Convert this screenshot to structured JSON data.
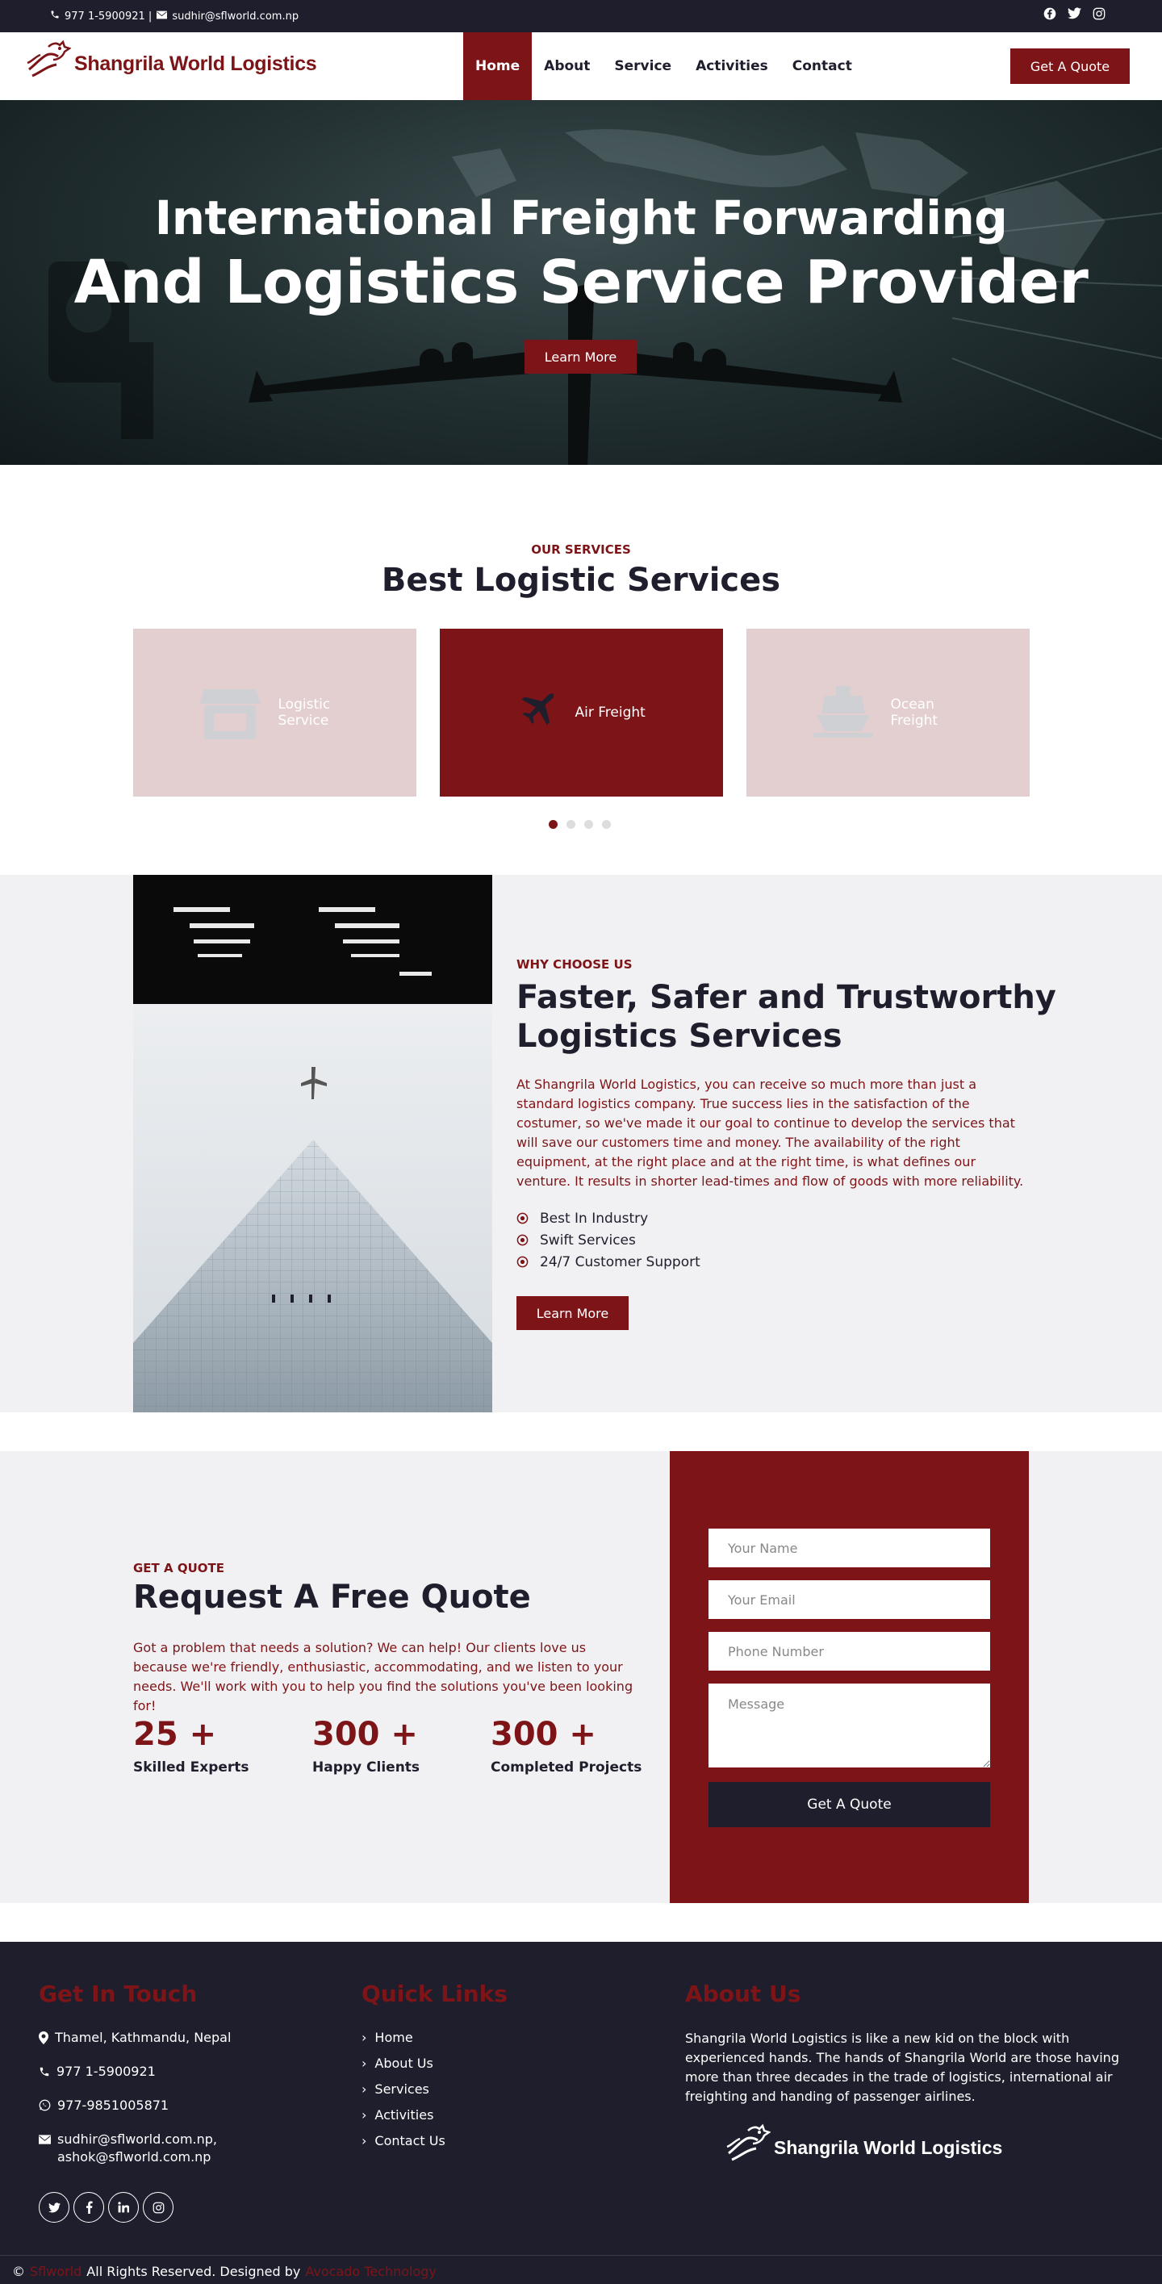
{
  "topbar": {
    "phone": "977 1-5900921 |",
    "email": "sudhir@sflworld.com.np",
    "social_icons": [
      "facebook-icon",
      "twitter-icon",
      "instagram-icon"
    ]
  },
  "brand": {
    "name": "Shangrila World Logistics",
    "accent": "#7d1518",
    "dark": "#1e1e2d",
    "light_bg": "#f1f1f3"
  },
  "nav": {
    "items": [
      "Home",
      "About",
      "Service",
      "Activities",
      "Contact"
    ],
    "active": "Home",
    "cta": "Get A Quote"
  },
  "hero": {
    "line1": "International Freight Forwarding",
    "line2": "And Logistics Service Provider",
    "button": "Learn More"
  },
  "services": {
    "label": "OUR SERVICES",
    "title": "Best Logistic Services",
    "cards": [
      {
        "label": "Logistic Service",
        "icon": "store-icon",
        "active": false
      },
      {
        "label": "Air Freight",
        "icon": "airplane-icon",
        "active": true
      },
      {
        "label": "Ocean Freight",
        "icon": "ship-icon",
        "active": false
      }
    ],
    "slide_count": 4,
    "active_slide": 1
  },
  "why": {
    "label": "WHY CHOOSE US",
    "title_line1": "Faster, Safer and Trustworthy",
    "title_line2": "Logistics Services",
    "body": "At Shangrila World Logistics, you can receive so much more than just a standard logistics company. True success lies in the satisfaction of the costumer, so we've made it our goal to continue to develop the services that will save our customers time and money. The availability of the right equipment, at the right place and at the right time, is what defines our venture. It results in shorter lead-times and flow of goods with more reliability.",
    "points": [
      "Best In Industry",
      "Swift Services",
      "24/7 Customer Support"
    ],
    "button": "Learn More"
  },
  "quote": {
    "label": "GET A QUOTE",
    "title": "Request A Free Quote",
    "body": "Got a problem that needs a solution? We can help! Our clients love us because we're friendly, enthusiastic, accommodating, and we listen to your needs. We'll work with you to help you find the solutions you've been looking for!",
    "stats": [
      {
        "num": "25 +",
        "caption": "Skilled Experts"
      },
      {
        "num": "300 +",
        "caption": "Happy Clients"
      },
      {
        "num": "300 +",
        "caption": "Completed Projects"
      }
    ],
    "form": {
      "name_placeholder": "Your Name",
      "email_placeholder": "Your Email",
      "phone_placeholder": "Phone Number",
      "message_placeholder": "Message",
      "submit": "Get A Quote"
    }
  },
  "footer": {
    "contact_title": "Get In Touch",
    "address": "Thamel, Kathmandu, Nepal",
    "phone": "977 1-5900921",
    "whatsapp": "977-9851005871",
    "email1": "sudhir@sflworld.com.np,",
    "email2": "ashok@sflworld.com.np",
    "links_title": "Quick Links",
    "links": [
      "Home",
      "About Us",
      "Services",
      "Activities",
      "Contact Us"
    ],
    "about_title": "About Us",
    "about_text": "Shangrila World Logistics is like a new kid on the block with experienced hands. The hands of Shangrila World are those having more than three decades in the trade of logistics, international air freighting and handing of passenger airlines.",
    "logo_text": "Shangrila World Logistics",
    "social_icons": [
      "twitter-icon",
      "facebook-icon",
      "linkedin-icon",
      "instagram-icon"
    ],
    "copy_symbol": "©",
    "copy_brand": "Sflworld",
    "copy_text": "All Rights Reserved. Designed by",
    "designer": "Avocado Technology"
  }
}
